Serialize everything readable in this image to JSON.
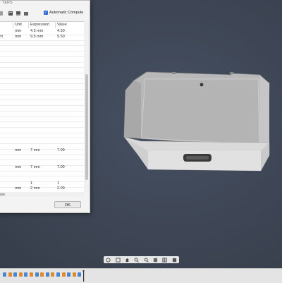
{
  "dialog": {
    "title": "TERS",
    "auto_compute_label": "Automatic Compute",
    "columns": {
      "unit": "Unit",
      "expression": "Expression",
      "value": "Value"
    },
    "rows": [
      {
        "name": "th",
        "unit": "mm",
        "expression": "4.5 mm",
        "value": "4.50"
      },
      {
        "name": "ight",
        "unit": "mm",
        "expression": "9.5 mm",
        "value": "9.50"
      },
      {
        "name": "",
        "unit": "",
        "expression": "",
        "value": ""
      },
      {
        "name": "",
        "unit": "",
        "expression": "",
        "value": ""
      },
      {
        "name": "",
        "unit": "",
        "expression": "",
        "value": ""
      },
      {
        "name": "",
        "unit": "",
        "expression": "",
        "value": ""
      },
      {
        "name": "",
        "unit": "",
        "expression": "",
        "value": ""
      },
      {
        "name": "",
        "unit": "",
        "expression": "",
        "value": ""
      },
      {
        "name": "",
        "unit": "",
        "expression": "",
        "value": ""
      },
      {
        "name": "",
        "unit": "",
        "expression": "",
        "value": ""
      },
      {
        "name": "",
        "unit": "",
        "expression": "",
        "value": ""
      },
      {
        "name": "",
        "unit": "",
        "expression": "",
        "value": ""
      },
      {
        "name": "",
        "unit": "",
        "expression": "",
        "value": ""
      },
      {
        "name": "",
        "unit": "",
        "expression": "",
        "value": ""
      },
      {
        "name": "",
        "unit": "",
        "expression": "",
        "value": ""
      },
      {
        "name": "",
        "unit": "",
        "expression": "",
        "value": ""
      },
      {
        "name": "",
        "unit": "",
        "expression": "",
        "value": ""
      },
      {
        "name": "",
        "unit": "",
        "expression": "",
        "value": ""
      },
      {
        "name": "",
        "unit": "",
        "expression": "",
        "value": ""
      },
      {
        "name": "",
        "unit": "",
        "expression": "",
        "value": ""
      },
      {
        "name": "",
        "unit": "",
        "expression": "",
        "value": ""
      },
      {
        "name": "",
        "unit": "",
        "expression": "",
        "value": ""
      },
      {
        "name": "",
        "unit": "mm",
        "expression": "7 mm",
        "value": "7.00"
      },
      {
        "name": "",
        "unit": "",
        "expression": "",
        "value": ""
      },
      {
        "name": "",
        "unit": "",
        "expression": "",
        "value": ""
      },
      {
        "name": "",
        "unit": "mm",
        "expression": "7 mm",
        "value": "7.00"
      },
      {
        "name": "",
        "unit": "",
        "expression": "",
        "value": ""
      },
      {
        "name": "",
        "unit": "",
        "expression": "",
        "value": ""
      },
      {
        "name": "",
        "unit": "",
        "expression": "1",
        "value": "1"
      },
      {
        "name": "",
        "unit": "mm",
        "expression": "2 mm",
        "value": "2.00"
      }
    ],
    "ok_label": "OK"
  },
  "colors": {
    "viewport_bg": "#3d4554",
    "accent": "#2d6ad8",
    "model_top": "#b9b9b9",
    "model_front": "#dcdcdc"
  },
  "navbar": {
    "icons": [
      "orbit-icon",
      "look-at-icon",
      "pan-icon",
      "zoom-icon",
      "fit-icon",
      "display-mode-icon",
      "grid-icon",
      "viewports-icon"
    ]
  },
  "timeline": {
    "features": [
      "sketch",
      "extrude",
      "sketch",
      "extrude",
      "sketch",
      "extrude",
      "sketch",
      "extrude",
      "sketch",
      "extrude",
      "sketch",
      "extrude",
      "sketch",
      "extrude",
      "sketch"
    ]
  }
}
